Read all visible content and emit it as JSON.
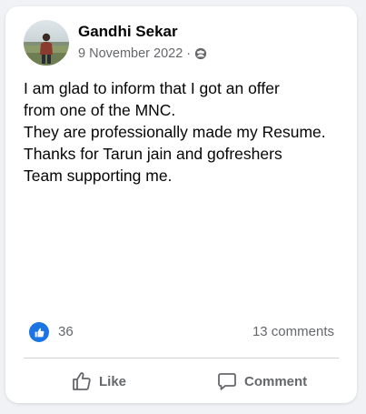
{
  "post": {
    "author": "Gandhi Sekar",
    "date": "9 November 2022",
    "separator": "·",
    "audience_icon": "public-group-icon",
    "body_lines": [
      "I am glad to inform that I got an offer",
      "from one of the MNC.",
      "They are professionally made my Resume.",
      "Thanks for Tarun jain and gofreshers",
      "Team supporting me."
    ]
  },
  "stats": {
    "reaction_icon": "like-reaction-icon",
    "like_count": "36",
    "comments": "13 comments"
  },
  "actions": {
    "like_label": "Like",
    "comment_label": "Comment"
  },
  "colors": {
    "accent": "#1b74e4",
    "text": "#050505",
    "muted": "#65676b",
    "card": "#ffffff",
    "background": "#f0f2f5"
  }
}
